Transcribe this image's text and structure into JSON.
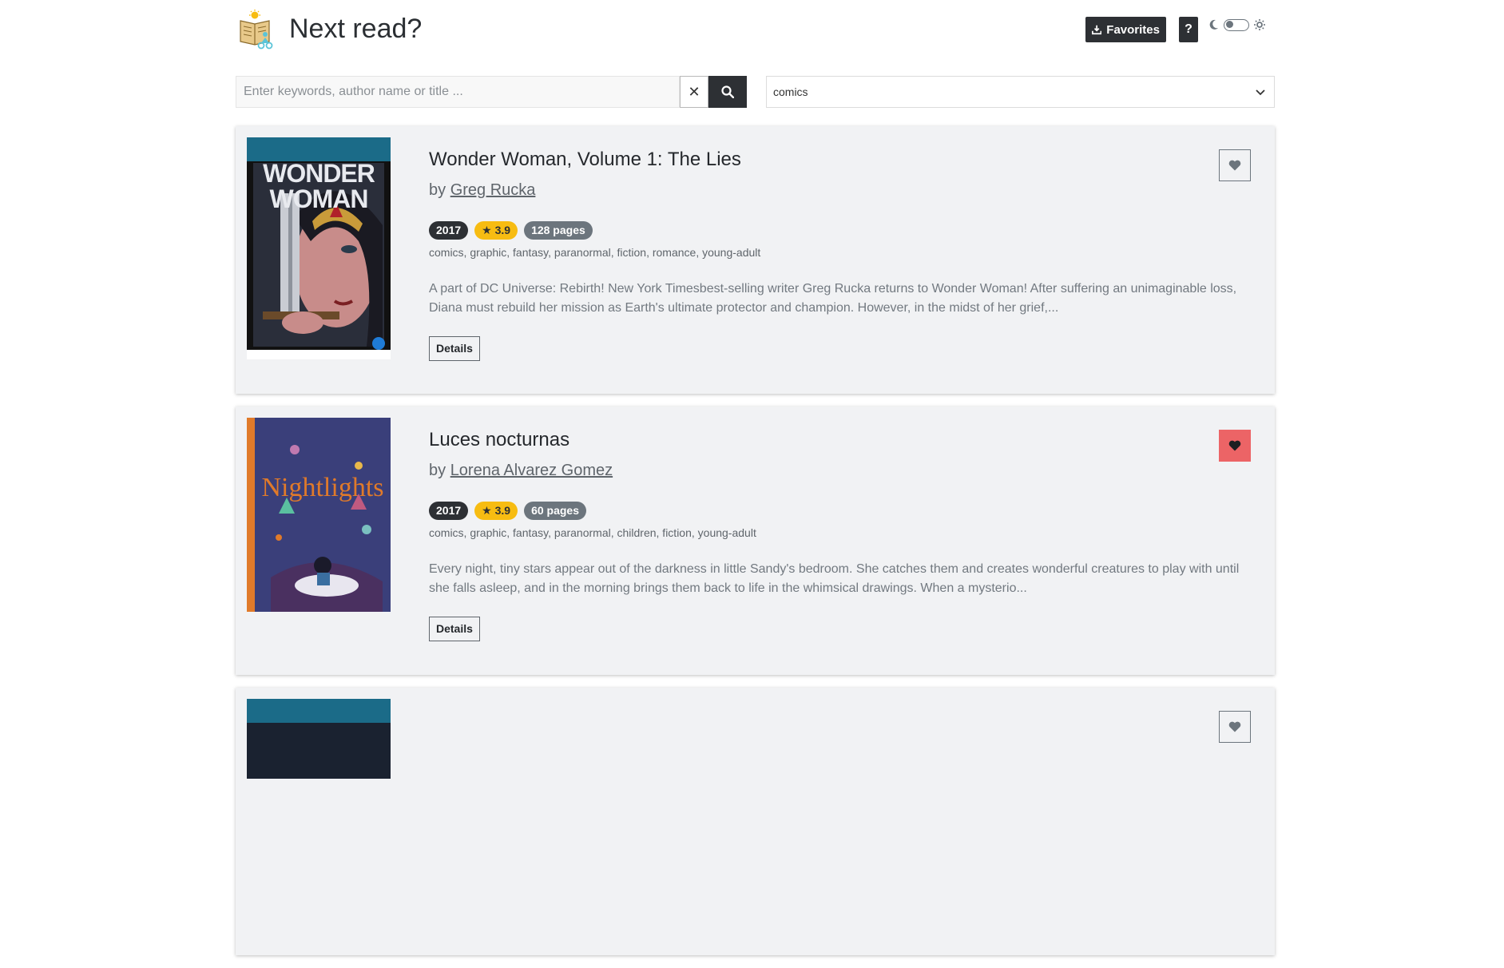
{
  "header": {
    "title": "Next read?",
    "favorites_label": "Favorites",
    "help_label": "?"
  },
  "search": {
    "placeholder": "Enter keywords, author name or title ...",
    "value": "",
    "clear_label": "✕",
    "genre_selected": "comics"
  },
  "books": [
    {
      "title": "Wonder Woman, Volume 1: The Lies",
      "by": "by",
      "author": "Greg Rucka",
      "year": "2017",
      "rating": "★ 3.9",
      "pages": "128 pages",
      "genres": "comics, graphic, fantasy, paranormal, fiction, romance, young-adult",
      "description": "A part of DC Universe: Rebirth! New York Timesbest-selling writer Greg Rucka returns to Wonder Woman! After suffering an unimaginable loss, Diana must rebuild her mission as Earth's ultimate protector and champion. However, in the midst of her grief,...",
      "details_label": "Details",
      "favorited": false
    },
    {
      "title": "Luces nocturnas",
      "by": "by",
      "author": "Lorena Alvarez Gomez",
      "year": "2017",
      "rating": "★ 3.9",
      "pages": "60 pages",
      "genres": "comics, graphic, fantasy, paranormal, children, fiction, young-adult",
      "description": "Every night, tiny stars appear out of the darkness in little Sandy's bedroom. She catches them and creates wonderful creatures to play with until she falls asleep, and in the morning brings them back to life in the whimsical drawings. When a mysterio...",
      "details_label": "Details",
      "favorited": true
    }
  ],
  "colors": {
    "dark": "#2d3034",
    "rating": "#f7bc12",
    "pages": "#6c757d",
    "favorite_active": "#ec6466",
    "card_bg": "#f1f2f4"
  }
}
